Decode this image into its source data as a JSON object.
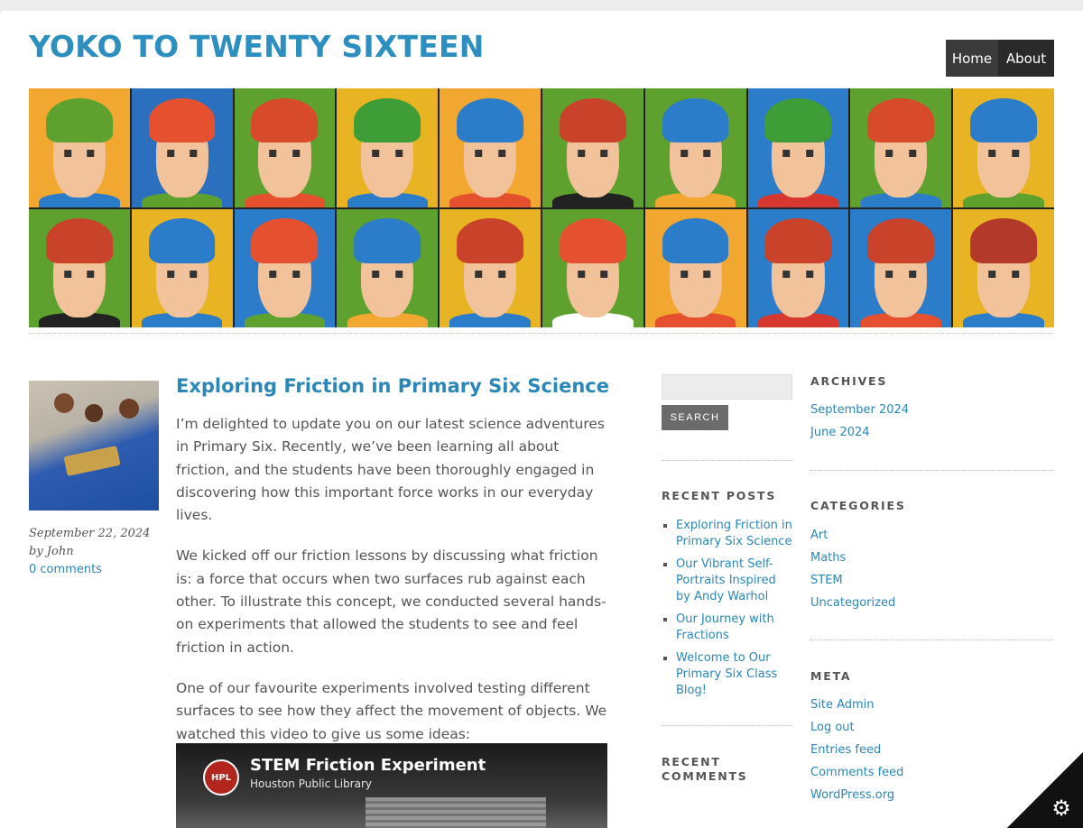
{
  "header": {
    "site_title": "YOKO TO TWENTY SIXTEEN",
    "nav": {
      "home": "Home",
      "about": "About"
    }
  },
  "banner": {
    "tiles": [
      {
        "bg": "#f2a830",
        "hair": "#5ea12e",
        "shirt": "#2b7cc9"
      },
      {
        "bg": "#2b6fbf",
        "hair": "#e5512f",
        "shirt": "#5ea12e"
      },
      {
        "bg": "#5ea12e",
        "hair": "#d84b2a",
        "shirt": "#e5512f"
      },
      {
        "bg": "#e8b423",
        "hair": "#3f9d38",
        "shirt": "#2b7cc9"
      },
      {
        "bg": "#f2a830",
        "hair": "#2b7cc9",
        "shirt": "#e5512f"
      },
      {
        "bg": "#5ea12e",
        "hair": "#c8432a",
        "shirt": "#222222"
      },
      {
        "bg": "#5ea12e",
        "hair": "#2b7cc9",
        "shirt": "#f2a830"
      },
      {
        "bg": "#2b7cc9",
        "hair": "#3f9d38",
        "shirt": "#d6382f"
      },
      {
        "bg": "#5ea12e",
        "hair": "#d84b2a",
        "shirt": "#2b7cc9"
      },
      {
        "bg": "#e8b423",
        "hair": "#2b7cc9",
        "shirt": "#5ea12e"
      },
      {
        "bg": "#5ea12e",
        "hair": "#c8432a",
        "shirt": "#222222"
      },
      {
        "bg": "#e8b423",
        "hair": "#2b7cc9",
        "shirt": "#2b7cc9"
      },
      {
        "bg": "#2b7cc9",
        "hair": "#e5512f",
        "shirt": "#5ea12e"
      },
      {
        "bg": "#5ea12e",
        "hair": "#2b7cc9",
        "shirt": "#f2a830"
      },
      {
        "bg": "#e8b423",
        "hair": "#c8432a",
        "shirt": "#2b7cc9"
      },
      {
        "bg": "#5ea12e",
        "hair": "#e5512f",
        "shirt": "#ffffff"
      },
      {
        "bg": "#f2a830",
        "hair": "#2b7cc9",
        "shirt": "#e5512f"
      },
      {
        "bg": "#2b7cc9",
        "hair": "#c8432a",
        "shirt": "#d6382f"
      },
      {
        "bg": "#2b7cc9",
        "hair": "#c8432a",
        "shirt": "#e5512f"
      },
      {
        "bg": "#e8b423",
        "hair": "#b33a2a",
        "shirt": "#2b7cc9"
      }
    ]
  },
  "post": {
    "title": "Exploring Friction in Primary Six Science",
    "date": "September 22, 2024",
    "author": "by John",
    "comments_link": "0 comments",
    "paragraphs": [
      "I’m delighted to update you on our latest science adventures in Primary Six. Recently, we’ve been learning all about friction, and the students have been thoroughly engaged in discovering how this important force works in our everyday lives.",
      "We kicked off our friction lessons by discussing what friction is: a force that occurs when two surfaces rub against each other. To illustrate this concept, we conducted several hands-on experiments that allowed the students to see and feel friction in action.",
      "One of our favourite experiments involved testing different surfaces to see how they affect the movement of objects. We watched this video to give us some ideas:"
    ],
    "video": {
      "title": "STEM Friction Experiment",
      "channel": "Houston Public Library",
      "logo_text": "HPL"
    }
  },
  "sidebar": {
    "search_button": "SEARCH",
    "recent_posts_heading": "RECENT POSTS",
    "recent_posts": [
      "Exploring Friction in Primary Six Science",
      "Our Vibrant Self-Portraits Inspired by Andy Warhol",
      "Our Journey with Fractions",
      "Welcome to Our Primary Six Class Blog!"
    ],
    "recent_comments_heading": "RECENT COMMENTS",
    "archives_heading": "ARCHIVES",
    "archives": [
      "September 2024",
      "June 2024"
    ],
    "categories_heading": "CATEGORIES",
    "categories": [
      "Art",
      "Maths",
      "STEM",
      "Uncategorized"
    ],
    "meta_heading": "META",
    "meta": [
      "Site Admin",
      "Log out",
      "Entries feed",
      "Comments feed",
      "WordPress.org"
    ]
  },
  "corner": {
    "icon": "gear-icon"
  }
}
